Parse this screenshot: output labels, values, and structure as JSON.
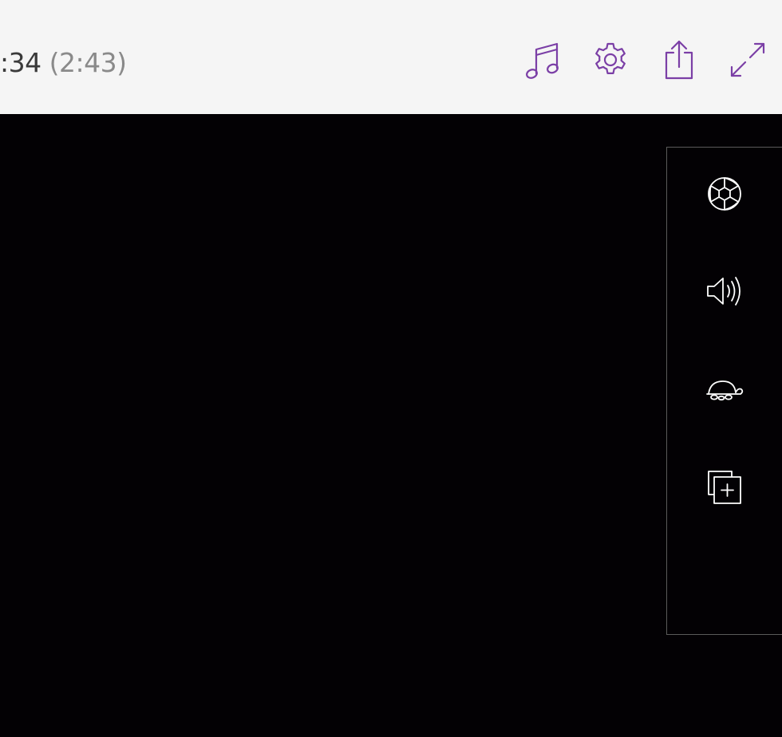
{
  "header": {
    "elapsed": ":34",
    "total": "(2:43)",
    "actions": [
      {
        "name": "music-icon",
        "accent": "#7b3fa6"
      },
      {
        "name": "gear-icon",
        "accent": "#7b3fa6"
      },
      {
        "name": "share-icon",
        "accent": "#7b3fa6"
      },
      {
        "name": "expand-icon",
        "accent": "#7b3fa6"
      }
    ]
  },
  "side_toolbar": {
    "items": [
      {
        "name": "aperture-icon"
      },
      {
        "name": "speaker-icon"
      },
      {
        "name": "turtle-icon"
      },
      {
        "name": "add-copy-icon"
      }
    ]
  },
  "colors": {
    "header_bg": "#f5f5f5",
    "accent": "#7b3fa6",
    "video_bg": "#030104",
    "panel_border": "#5a5a5a",
    "panel_icon": "#ffffff"
  }
}
